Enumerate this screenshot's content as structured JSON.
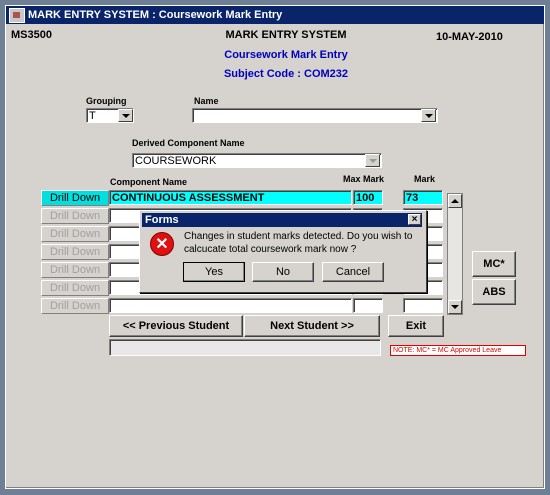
{
  "window": {
    "title": "MARK ENTRY SYSTEM : Coursework Mark Entry"
  },
  "header": {
    "screen_code": "MS3500",
    "system_name": "MARK ENTRY SYSTEM",
    "subtitle": "Coursework Mark Entry",
    "subject_line": "Subject Code : COM232",
    "date": "10-MAY-2010"
  },
  "filters": {
    "grouping_label": "Grouping",
    "grouping_value": "T",
    "name_label": "Name",
    "name_value": "",
    "derived_label": "Derived Component Name",
    "derived_value": "COURSEWORK"
  },
  "table": {
    "col_component": "Component Name",
    "col_max": "Max Mark",
    "col_mark": "Mark",
    "drill_label": "Drill Down",
    "rows": [
      {
        "component": "CONTINUOUS ASSESSMENT",
        "max": "100",
        "mark": "73"
      },
      {
        "component": "",
        "max": "",
        "mark": ""
      },
      {
        "component": "",
        "max": "",
        "mark": ""
      },
      {
        "component": "",
        "max": "",
        "mark": ""
      },
      {
        "component": "",
        "max": "",
        "mark": ""
      },
      {
        "component": "",
        "max": "",
        "mark": ""
      },
      {
        "component": "",
        "max": "",
        "mark": ""
      }
    ]
  },
  "buttons": {
    "prev_student": "<<   Previous Student",
    "next_student": "Next Student   >>",
    "exit": "Exit",
    "mc": "MC*",
    "abs": "ABS"
  },
  "note": "NOTE:  MC* = MC Approved Leave",
  "dialog": {
    "title": "Forms",
    "close": "×",
    "message_line1": "Changes in student marks detected. Do you wish to",
    "message_line2": "calcucate total coursework mark now ?",
    "yes": "Yes",
    "no": "No",
    "cancel": "Cancel"
  },
  "colors": {
    "title_bar": "#0a246a",
    "highlight": "#00ffff",
    "accent_text": "#0000c0",
    "note_red": "#e00000"
  }
}
